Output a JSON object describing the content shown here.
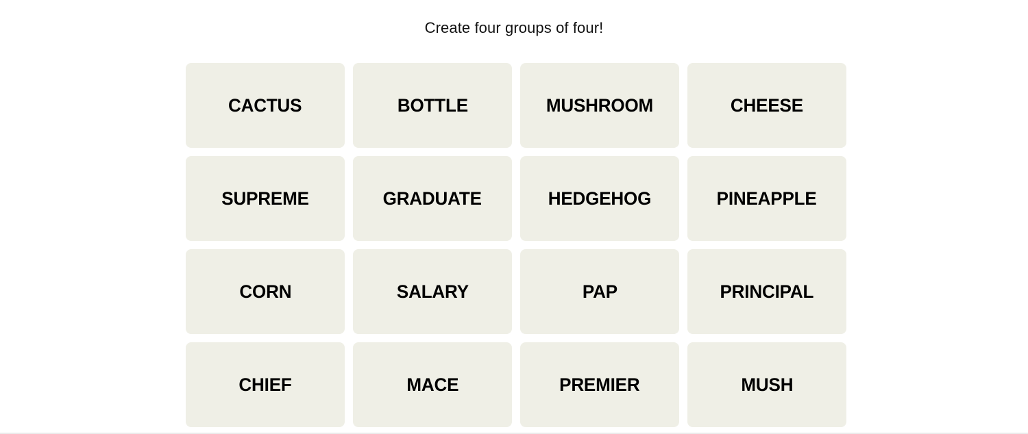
{
  "page": {
    "background_color": "#ffffff",
    "divider_color": "#ebebeb"
  },
  "board": {
    "instruction": "Create four groups of four!",
    "tile_color": "#efefe6",
    "tile_text_color": "#000000",
    "columns": 4,
    "rows": 4,
    "tiles": [
      {
        "label": "CACTUS"
      },
      {
        "label": "BOTTLE"
      },
      {
        "label": "MUSHROOM"
      },
      {
        "label": "CHEESE"
      },
      {
        "label": "SUPREME"
      },
      {
        "label": "GRADUATE"
      },
      {
        "label": "HEDGEHOG"
      },
      {
        "label": "PINEAPPLE"
      },
      {
        "label": "CORN"
      },
      {
        "label": "SALARY"
      },
      {
        "label": "PAP"
      },
      {
        "label": "PRINCIPAL"
      },
      {
        "label": "CHIEF"
      },
      {
        "label": "MACE"
      },
      {
        "label": "PREMIER"
      },
      {
        "label": "MUSH"
      }
    ]
  }
}
